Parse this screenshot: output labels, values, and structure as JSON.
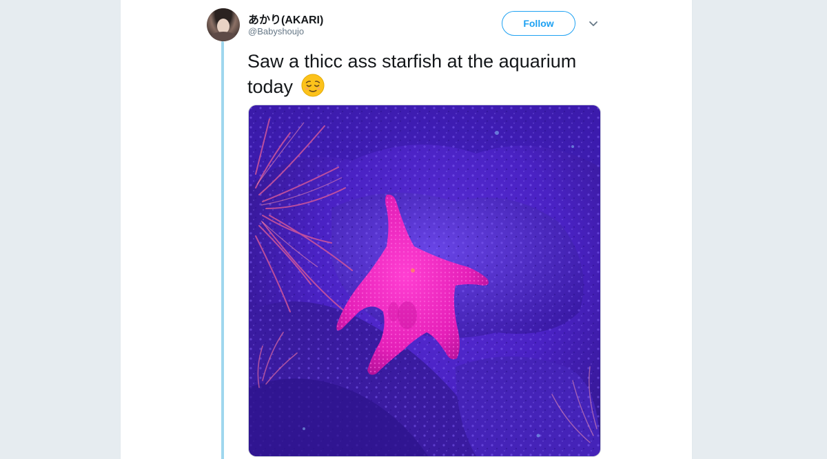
{
  "tweet": {
    "author": {
      "display_name": "あかり(AKARI)",
      "username": "@Babyshoujo"
    },
    "follow_label": "Follow",
    "text_line1": "Saw a thicc ass starfish at the aquarium",
    "text_line2": "today",
    "emoji": "relieved-face-emoji",
    "media": {
      "description_icon": "photo"
    }
  },
  "colors": {
    "accent": "#1da1f2",
    "thread_line": "#9fd7ee",
    "text": "#14171a",
    "secondary_text": "#657786"
  }
}
